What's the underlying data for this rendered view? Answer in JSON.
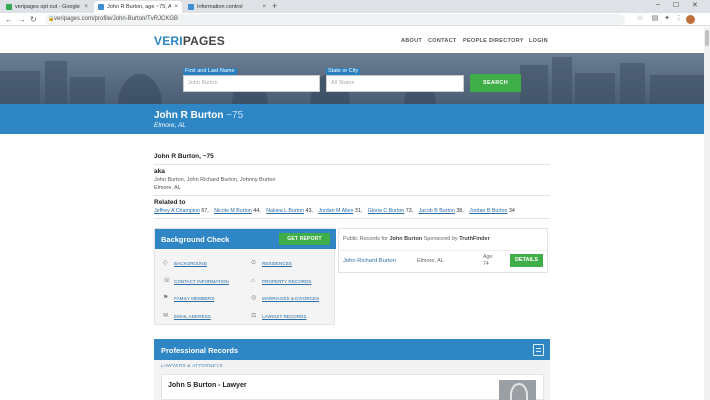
{
  "browser": {
    "tabs": [
      {
        "title": "veripages opt out - Google Sea"
      },
      {
        "title": "John R Burton, age ~75, Addres"
      },
      {
        "title": "Information control"
      }
    ],
    "url": "veripages.com/profile/John-Burton/TvRJCKGB",
    "new_tab": "+",
    "close": "×"
  },
  "site": {
    "logo_a": "VERI",
    "logo_b": "PAGES",
    "nav": [
      "ABOUT",
      "CONTACT",
      "PEOPLE DIRECTORY",
      "LOGIN"
    ]
  },
  "search": {
    "name_label": "First and Last Name",
    "name_placeholder": "John Burton",
    "state_label": "State or City",
    "state_placeholder": "All States",
    "button": "SEARCH"
  },
  "profile": {
    "name": "John R Burton",
    "age": "~75",
    "location": "Elmore, AL",
    "heading": "John R Burton, ~75",
    "aka_label": "aka",
    "aka_list": "John Burton, John Richard Burton, Johnny Burton",
    "aka_location": "Elmore, AL",
    "related_label": "Related to",
    "related": [
      {
        "name": "Jeffrey A Champion",
        "age": "67,"
      },
      {
        "name": "Nicole M Burton",
        "age": "44,"
      },
      {
        "name": "Nakiea L Burton",
        "age": "43,"
      },
      {
        "name": "Jordan M Allen",
        "age": "31,"
      },
      {
        "name": "Gloria C Burton",
        "age": "73,"
      },
      {
        "name": "Jacob B Burton",
        "age": "38,"
      },
      {
        "name": "Jordan B Burton",
        "age": "34"
      }
    ]
  },
  "background_check": {
    "title": "Background Check",
    "button": "GET REPORT",
    "items": [
      "BACKGROUND",
      "RESIDENCES",
      "CONTACT INFORMATION",
      "PROPERTY RECORDS",
      "FAMILY MEMBERS",
      "MARRIAGES & DIVORCES",
      "EMAIL ADDRESS",
      "LAWSUIT RECORDS"
    ]
  },
  "public_records": {
    "prefix": "Public Records for",
    "name": "John Burton",
    "sponsored": "Sponsored by",
    "sponsor": "TruthFinder",
    "result_name": "John Richard Burton",
    "result_location": "Elmore, AL",
    "result_age": "Age: 74",
    "button": "DETAILS"
  },
  "professional": {
    "title": "Professional Records",
    "subtitle": "LAWYERS & ATTORNEYS",
    "lawyer_name": "John S Burton - Lawyer"
  }
}
